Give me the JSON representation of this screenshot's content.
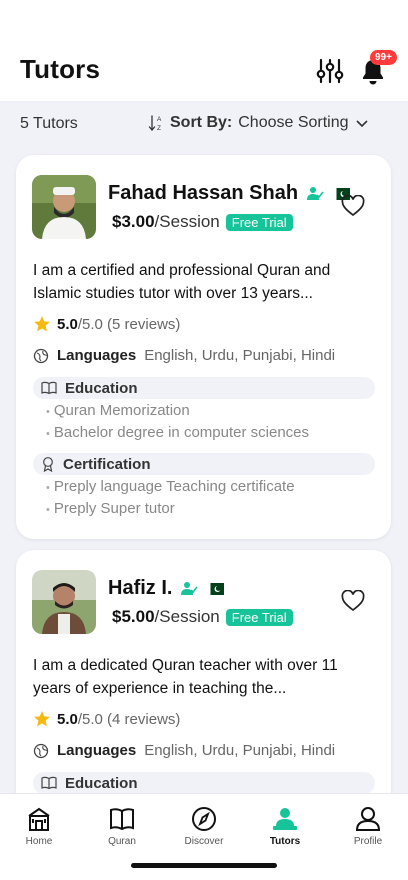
{
  "header": {
    "title": "Tutors",
    "notification_badge": "99+"
  },
  "toolbar": {
    "count": "5 Tutors",
    "sort_label": "Sort By:",
    "sort_value": "Choose Sorting"
  },
  "tutors": [
    {
      "name": "Fahad Hassan Shah",
      "price": "$3.00",
      "price_unit": "/Session",
      "trial": "Free Trial",
      "description": "I am a certified and professional Quran and Islamic studies tutor with over 13 years...",
      "rating": "5.0",
      "rating_rest": "/5.0 (5 reviews)",
      "languages_label": "Languages",
      "languages": "English, Urdu, Punjabi, Hindi",
      "education_label": "Education",
      "education": [
        "Quran Memorization",
        "Bachelor degree in computer sciences"
      ],
      "certification_label": "Certification",
      "certification": [
        "Preply language Teaching certificate",
        "Preply Super tutor"
      ]
    },
    {
      "name": "Hafiz I.",
      "price": "$5.00",
      "price_unit": "/Session",
      "trial": "Free Trial",
      "description": "I am a dedicated Quran teacher with over 11 years of experience in teaching the...",
      "rating": "5.0",
      "rating_rest": "/5.0 (4 reviews)",
      "languages_label": "Languages",
      "languages": "English, Urdu, Punjabi, Hindi",
      "education_label": "Education"
    }
  ],
  "tabbar": {
    "items": [
      {
        "label": "Home",
        "icon": "home-icon"
      },
      {
        "label": "Quran",
        "icon": "book-icon"
      },
      {
        "label": "Discover",
        "icon": "compass-icon"
      },
      {
        "label": "Tutors",
        "icon": "tutor-icon"
      },
      {
        "label": "Profile",
        "icon": "profile-icon"
      }
    ],
    "active": "Tutors"
  },
  "colors": {
    "accent": "#17c49a",
    "badge": "#ff3b3b",
    "background": "#f1f2f7",
    "star": "#f5b90f"
  }
}
